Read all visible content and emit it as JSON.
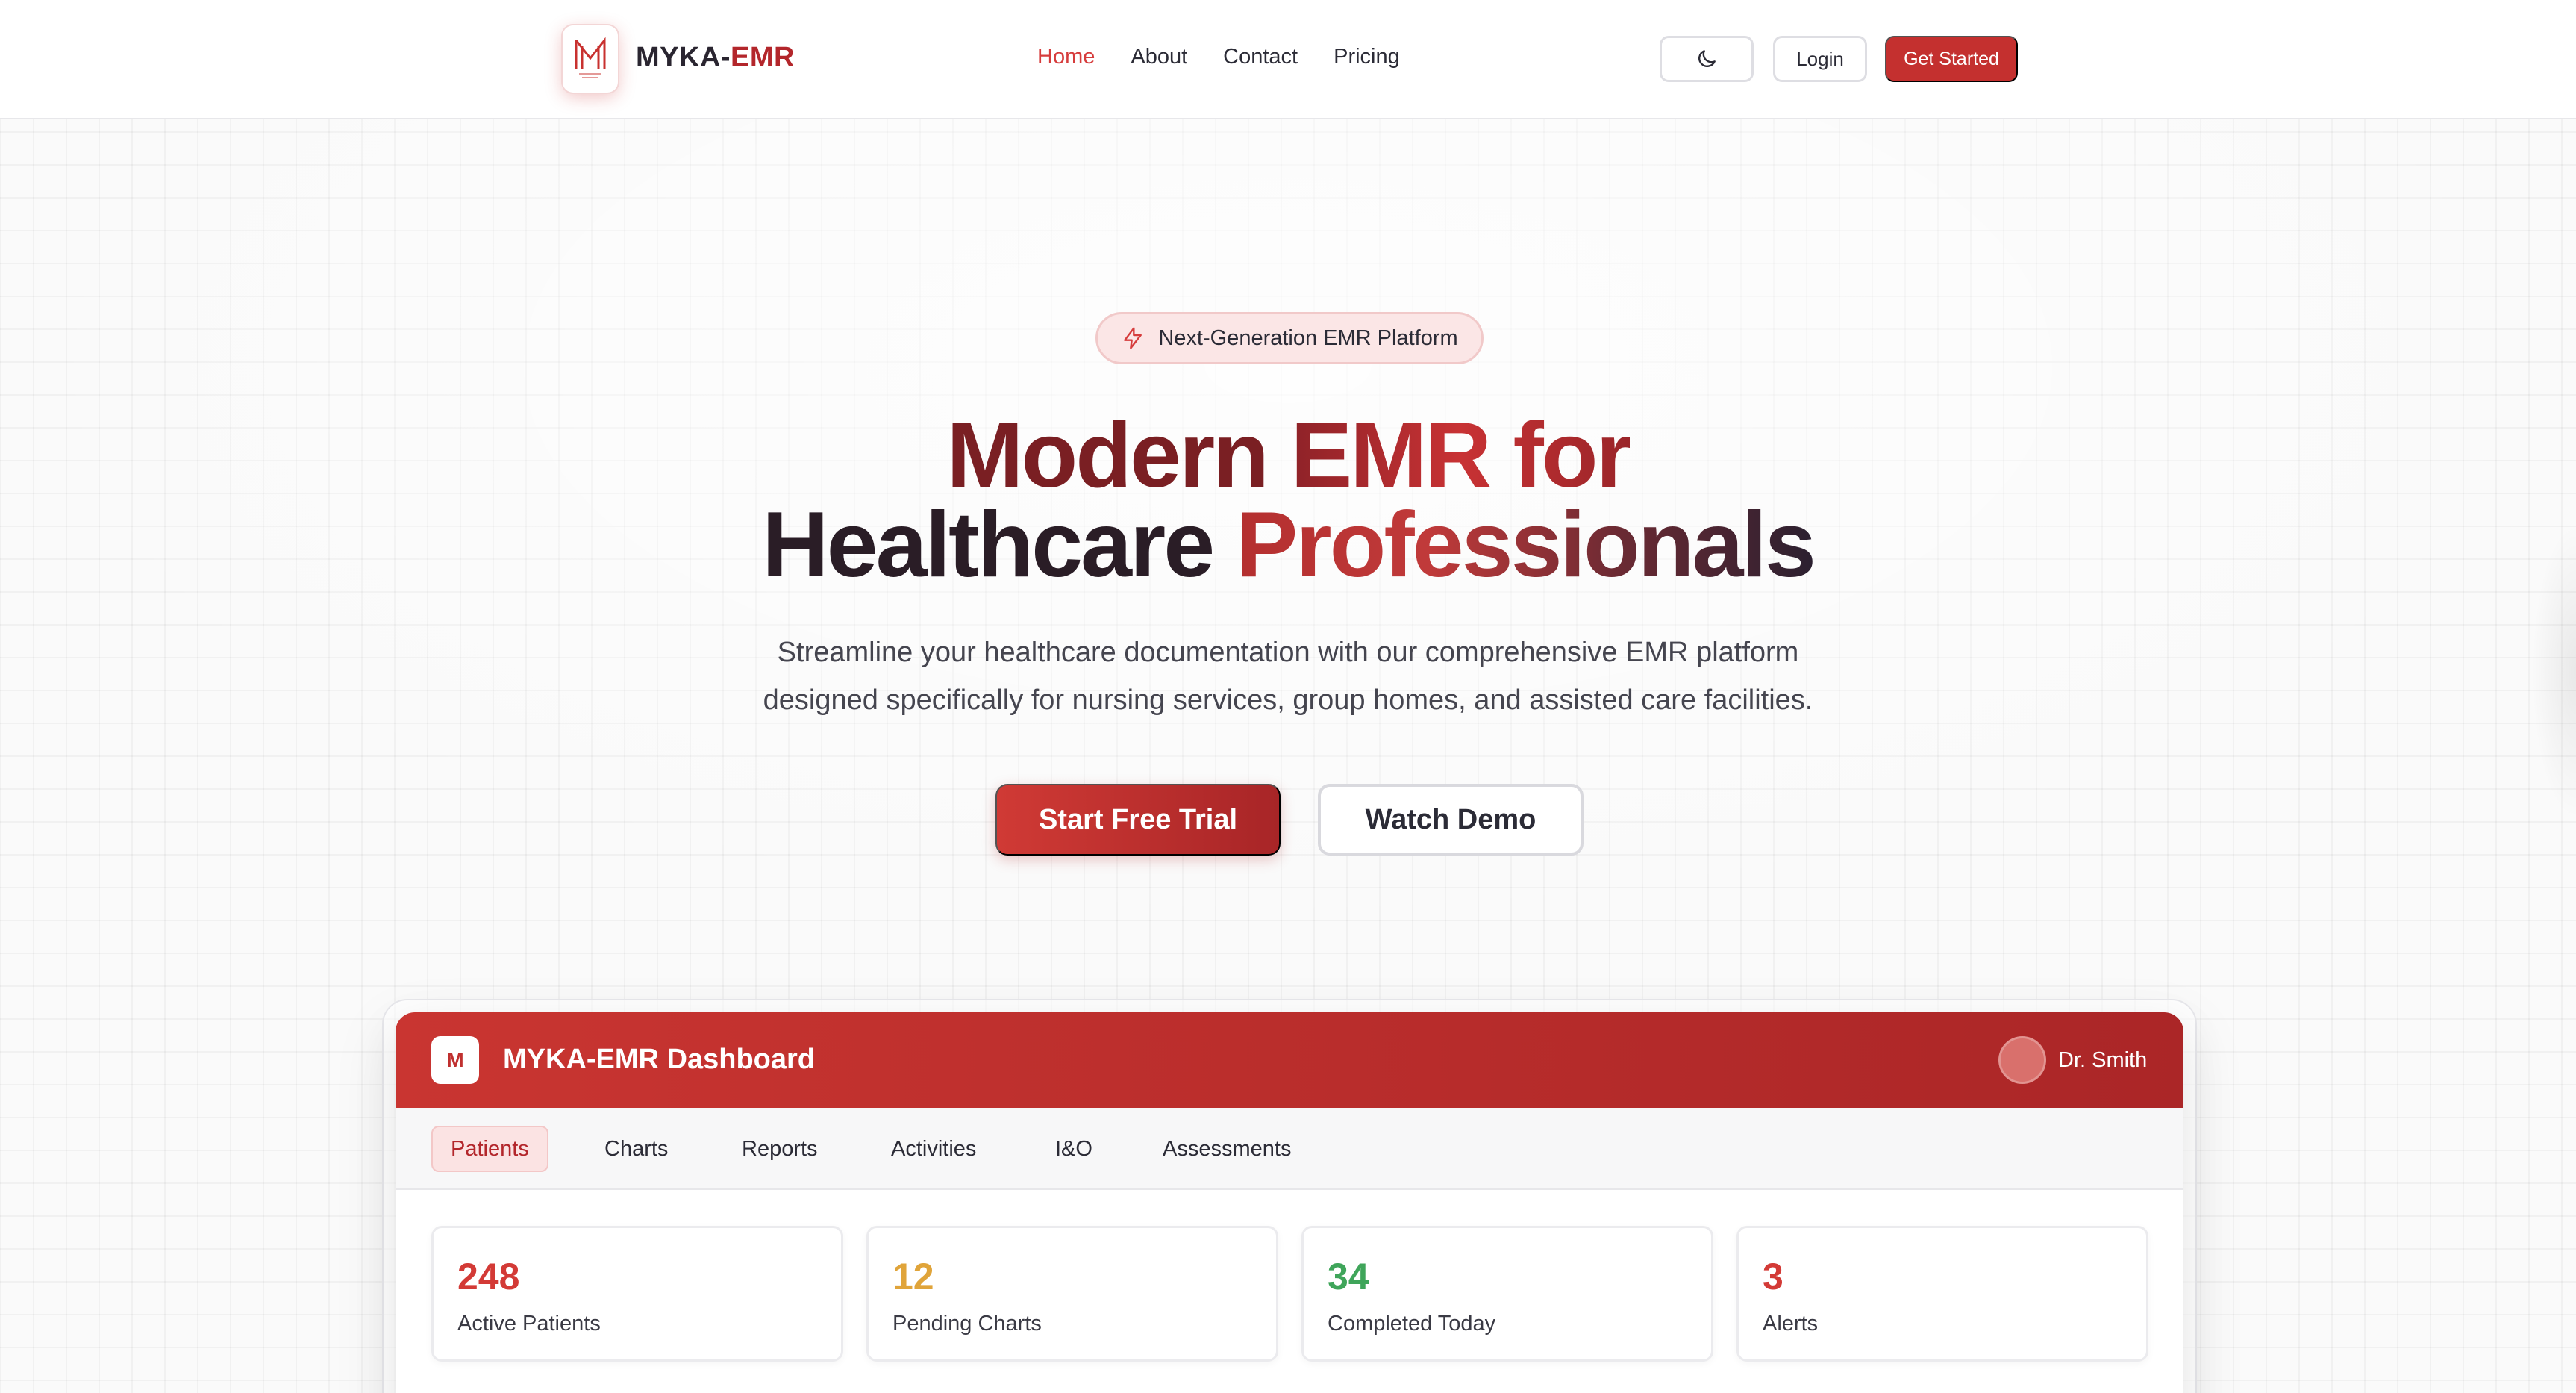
{
  "brand": {
    "prefix": "MYKA-",
    "suffix": "EMR",
    "logo_letter": "M"
  },
  "nav": {
    "links": [
      {
        "label": "Home",
        "active": true
      },
      {
        "label": "About"
      },
      {
        "label": "Contact"
      },
      {
        "label": "Pricing"
      }
    ],
    "theme_toggle_icon": "moon-icon",
    "login_label": "Login",
    "get_started_label": "Get Started"
  },
  "hero": {
    "badge": {
      "icon": "lightning-icon",
      "text": "Next-Generation EMR Platform"
    },
    "title_line1_a": "Modern ",
    "title_line1_b": "EMR for",
    "title_line2_a": "Healthcare ",
    "title_line2_b": "Professionals",
    "subtitle_line1": "Streamline your healthcare documentation with our comprehensive EMR platform",
    "subtitle_line2": "designed specifically for nursing services, group homes, and assisted care facilities.",
    "primary_cta": "Start Free Trial",
    "secondary_cta": "Watch Demo"
  },
  "dashboard": {
    "logo_letter": "M",
    "title": "MYKA-EMR Dashboard",
    "user_name": "Dr. Smith",
    "tabs": [
      "Patients",
      "Charts",
      "Reports",
      "Activities",
      "I&O",
      "Assessments"
    ],
    "active_tab": "Patients",
    "stats": [
      {
        "value": "248",
        "label": "Active Patients",
        "color": "#d33a36"
      },
      {
        "value": "12",
        "label": "Pending Charts",
        "color": "#e0a43a"
      },
      {
        "value": "34",
        "label": "Completed Today",
        "color": "#3fa55a"
      },
      {
        "value": "3",
        "label": "Alerts",
        "color": "#d33a36"
      }
    ]
  },
  "colors": {
    "accent": "#c4302f",
    "accent_dark": "#7a1f23",
    "badge_bg": "#fbe6e6"
  }
}
